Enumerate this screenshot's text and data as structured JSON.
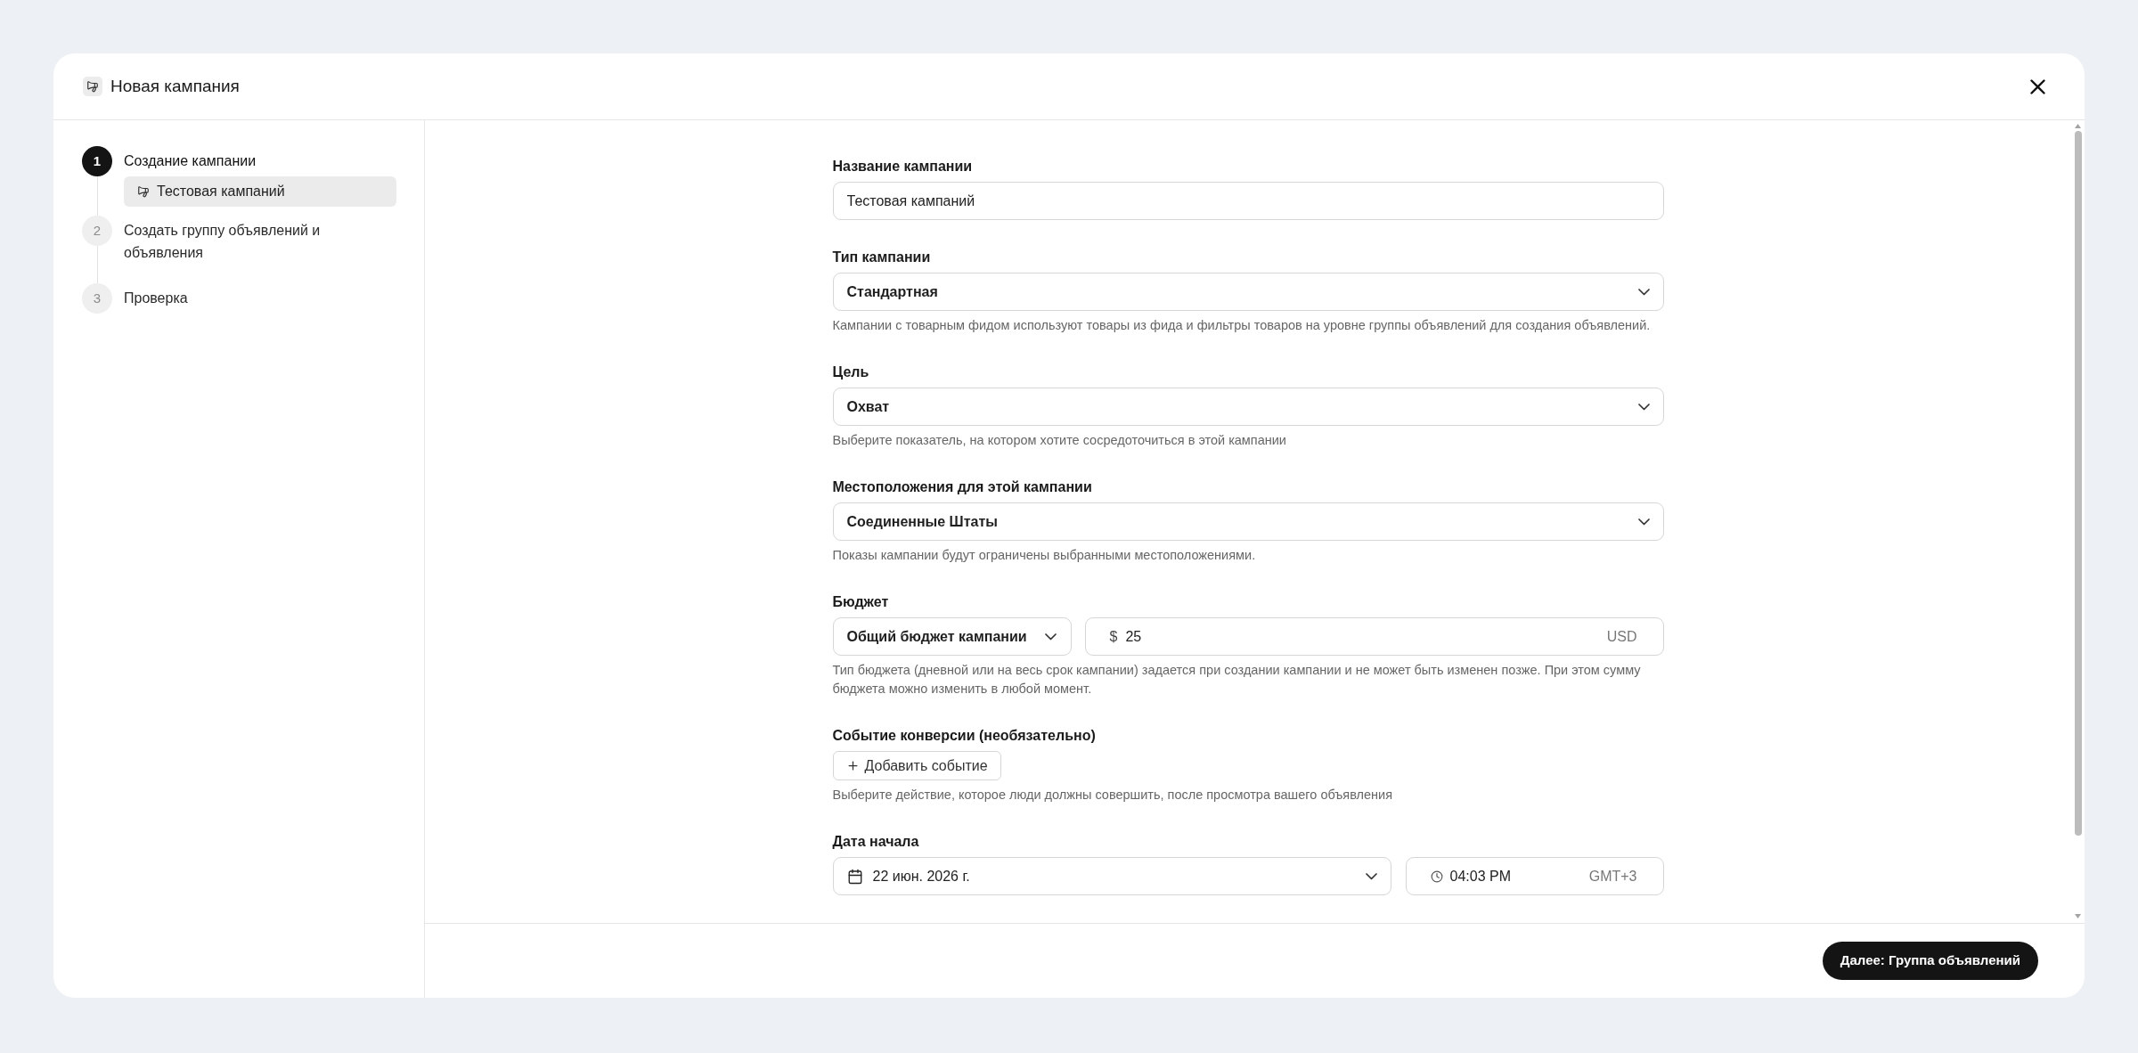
{
  "dialog": {
    "title": "Новая кампания"
  },
  "steps": [
    {
      "number": "1",
      "title": "Создание кампании",
      "selected": true,
      "children": [
        {
          "label": "Тестовая кампаний",
          "selected": true
        }
      ]
    },
    {
      "number": "2",
      "title": "Создать группу объявлений и объявления",
      "selected": false
    },
    {
      "number": "3",
      "title": "Проверка",
      "selected": false
    }
  ],
  "form": {
    "fields": [
      {
        "kind": "text",
        "label": "Название кампании",
        "value": "Тестовая кампаний"
      },
      {
        "kind": "select",
        "label": "Тип кампании",
        "value": "Стандартная",
        "help": "Кампании с товарным фидом используют товары из фида и фильтры товаров на уровне группы объявлений для создания объявлений."
      },
      {
        "kind": "select",
        "label": "Цель",
        "value": "Охват",
        "help": "Выберите показатель, на котором хотите сосредоточиться в этой кампании"
      },
      {
        "kind": "select",
        "label": "Местоположения для этой кампании",
        "value": "Соединенные Штаты",
        "help": "Показы кампании будут ограничены выбранными местоположениями."
      },
      {
        "kind": "budget",
        "label": "Бюджет",
        "budget_type": "Общий бюджет кампании",
        "currency_symbol": "$",
        "amount": "25",
        "currency": "USD",
        "help": "Тип бюджета (дневной или на весь срок кампании) задается при создании кампании и не может быть изменен позже. При этом сумму бюджета можно изменить в любой момент."
      },
      {
        "kind": "action",
        "label": "Событие конверсии (необязательно)",
        "button": "Добавить событие",
        "help": "Выберите действие, которое люди должны совершить, после просмотра вашего объявления"
      },
      {
        "kind": "datetime",
        "label": "Дата начала",
        "date": "22 июн. 2026 г.",
        "time": "04:03 PM",
        "timezone": "GMT+3"
      }
    ]
  },
  "footer": {
    "next_button": "Далее: Группа объявлений"
  }
}
